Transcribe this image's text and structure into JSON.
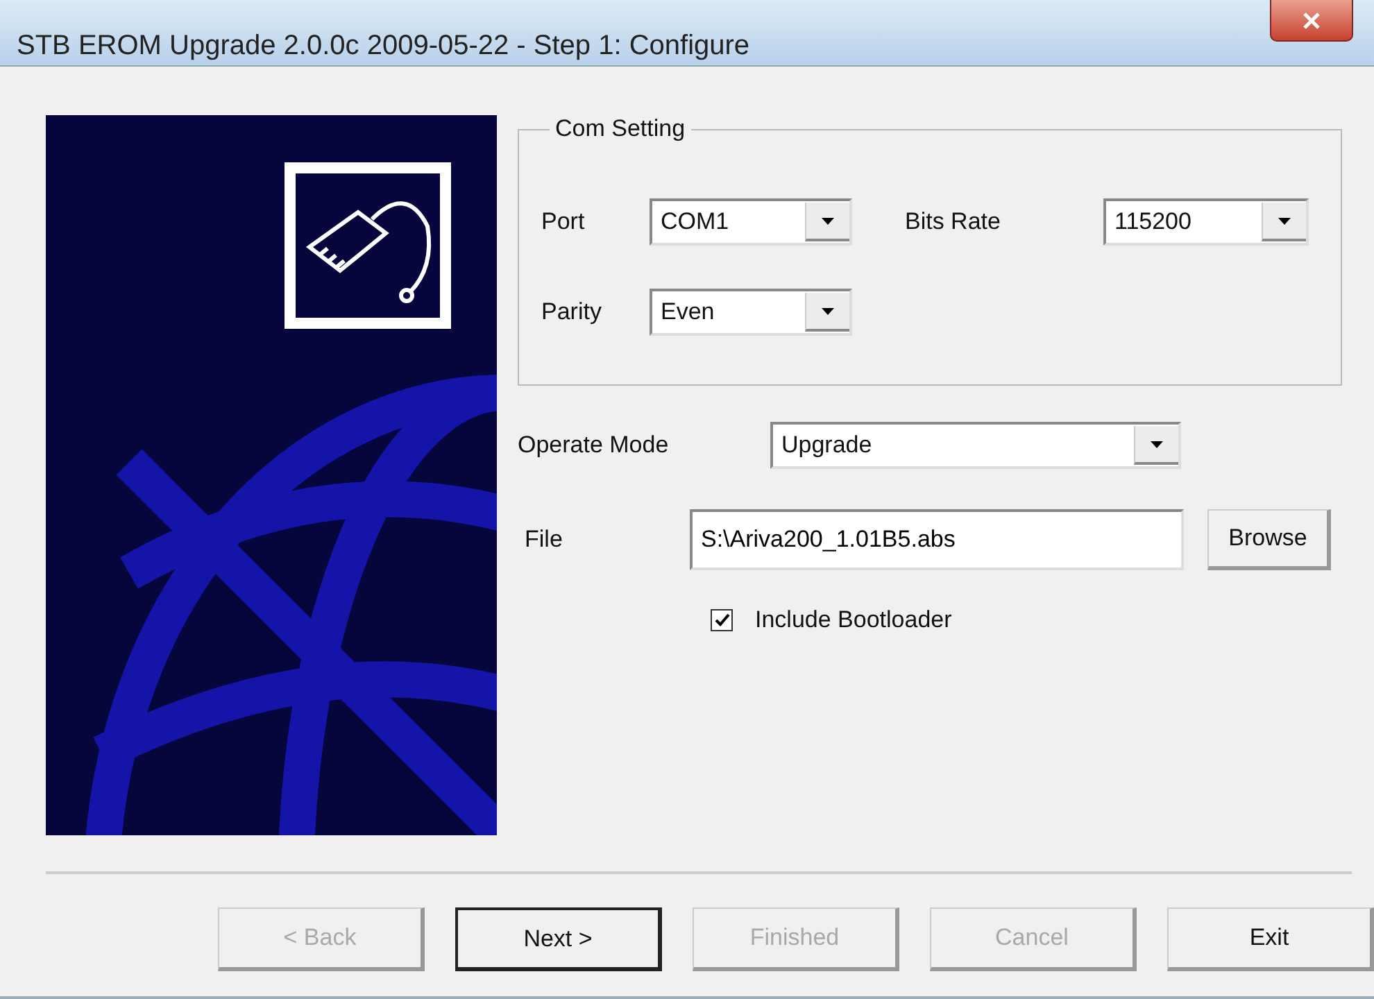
{
  "window": {
    "title": "STB EROM Upgrade 2.0.0c 2009-05-22 - Step 1: Configure"
  },
  "com_setting": {
    "title": "Com Setting",
    "fields": [
      {
        "label": "Port",
        "value": "COM1"
      },
      {
        "label": "Bits Rate",
        "value": "115200"
      },
      {
        "label": "Parity",
        "value": "Even"
      }
    ]
  },
  "operate_mode": {
    "label": "Operate Mode",
    "value": "Upgrade"
  },
  "file": {
    "label": "File",
    "value": "S:\\Ariva200_1.01B5.abs",
    "button": "Browse"
  },
  "include_bootloader": {
    "label": "Include Bootloader",
    "checked": true
  },
  "buttons": [
    {
      "label": "< Back",
      "disabled": true,
      "default": false
    },
    {
      "label": "Next >",
      "disabled": false,
      "default": true
    },
    {
      "label": "Finished",
      "disabled": true,
      "default": false
    },
    {
      "label": "Cancel",
      "disabled": true,
      "default": false
    },
    {
      "label": "Exit",
      "disabled": false,
      "default": false
    }
  ]
}
